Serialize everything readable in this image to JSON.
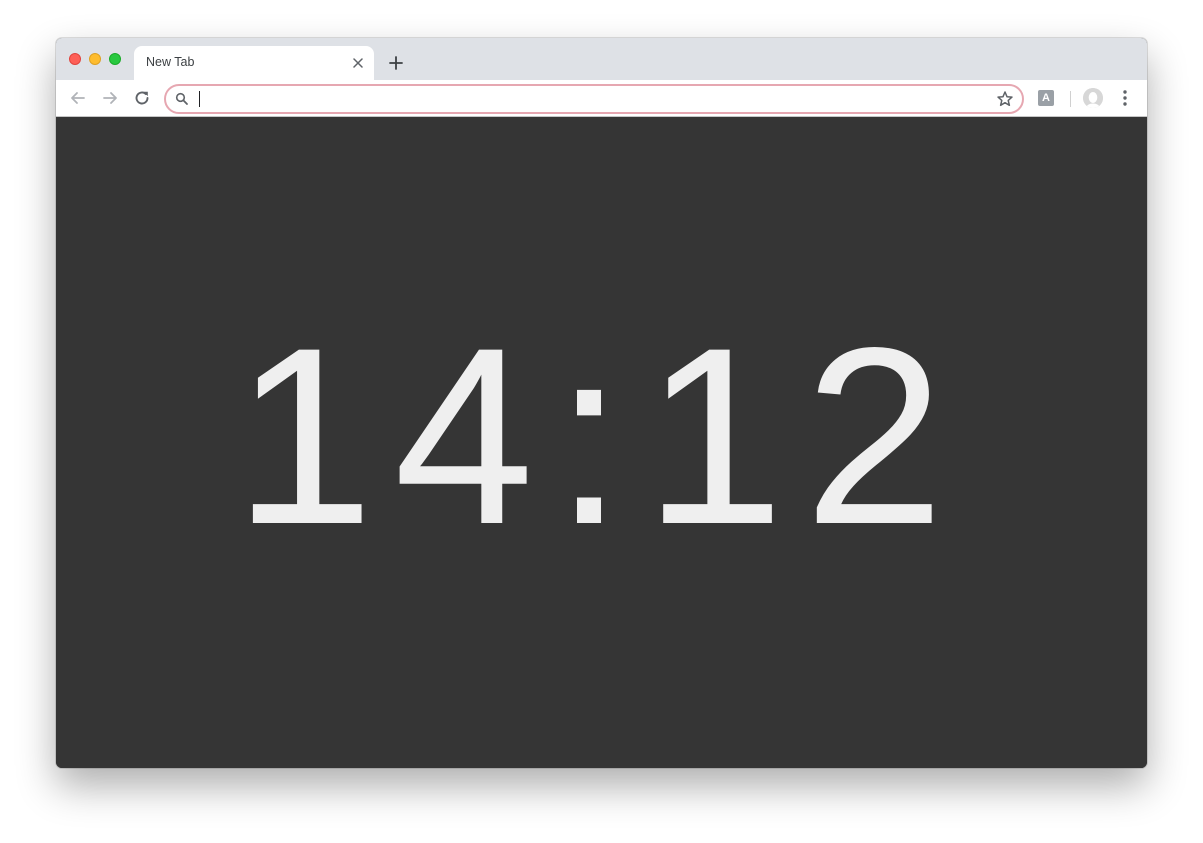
{
  "browser": {
    "tab": {
      "title": "New Tab"
    },
    "omnibox": {
      "value": "",
      "placeholder": ""
    },
    "extension_badge": "A"
  },
  "page": {
    "clock_time": "14:12",
    "background_color": "#353535",
    "text_color": "#efefef"
  },
  "icons": {
    "close": "close-icon",
    "new_tab": "plus-icon",
    "back": "arrow-left-icon",
    "forward": "arrow-right-icon",
    "reload": "reload-icon",
    "search": "search-icon",
    "bookmark": "star-icon",
    "account": "avatar-icon",
    "menu": "kebab-menu-icon"
  }
}
